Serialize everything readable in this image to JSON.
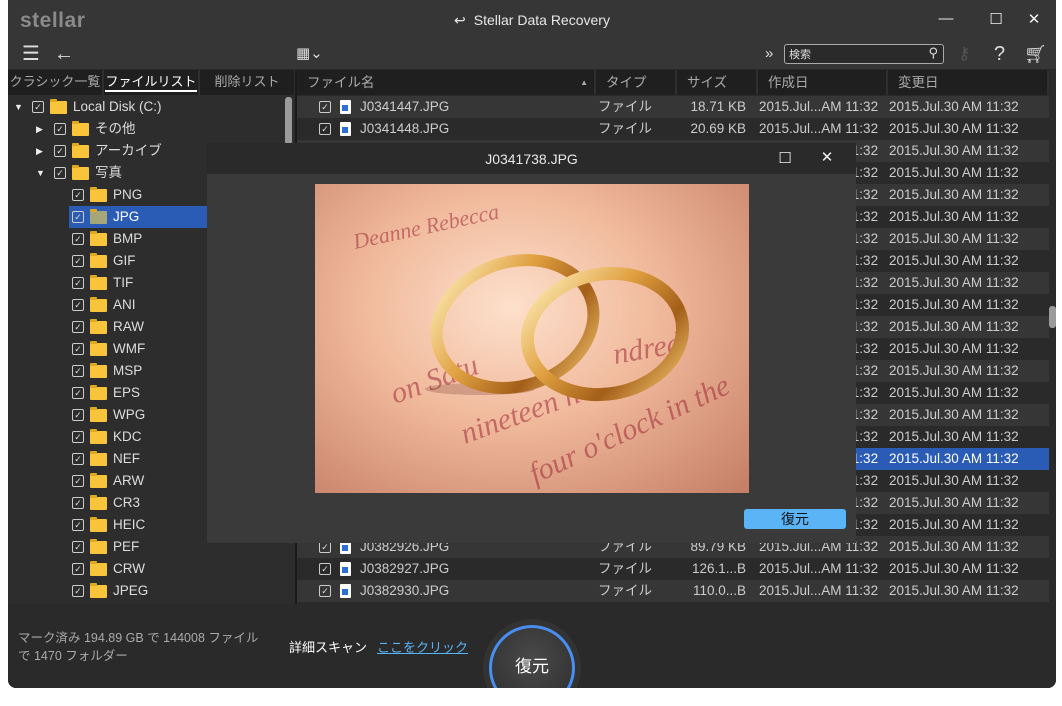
{
  "app": {
    "logo": "stellar",
    "title": "Stellar Data Recovery"
  },
  "window_controls": {
    "minimize": "—",
    "maximize": "☐",
    "close": "✕"
  },
  "toolbar": {
    "search_placeholder": "検索",
    "help": "?"
  },
  "tabs": [
    {
      "label": "クラシック一覧",
      "active": false
    },
    {
      "label": "ファイルリスト",
      "active": true
    },
    {
      "label": "削除リスト",
      "active": false
    }
  ],
  "tree": [
    {
      "label": "Local Disk (C:)",
      "level": 0,
      "arrow": "down"
    },
    {
      "label": "その他",
      "level": 1,
      "arrow": "right"
    },
    {
      "label": "アーカイブ",
      "level": 1,
      "arrow": "right"
    },
    {
      "label": "写真",
      "level": 1,
      "arrow": "down"
    },
    {
      "label": "PNG",
      "level": 2
    },
    {
      "label": "JPG",
      "level": 2,
      "selected": true
    },
    {
      "label": "BMP",
      "level": 2
    },
    {
      "label": "GIF",
      "level": 2
    },
    {
      "label": "TIF",
      "level": 2
    },
    {
      "label": "ANI",
      "level": 2
    },
    {
      "label": "RAW",
      "level": 2
    },
    {
      "label": "WMF",
      "level": 2
    },
    {
      "label": "MSP",
      "level": 2
    },
    {
      "label": "EPS",
      "level": 2
    },
    {
      "label": "WPG",
      "level": 2
    },
    {
      "label": "KDC",
      "level": 2
    },
    {
      "label": "NEF",
      "level": 2
    },
    {
      "label": "ARW",
      "level": 2
    },
    {
      "label": "CR3",
      "level": 2
    },
    {
      "label": "HEIC",
      "level": 2
    },
    {
      "label": "PEF",
      "level": 2
    },
    {
      "label": "CRW",
      "level": 2
    },
    {
      "label": "JPEG",
      "level": 2
    }
  ],
  "columns": [
    "ファイル名",
    "タイプ",
    "サイズ",
    "作成日",
    "変更日"
  ],
  "rows": [
    {
      "name": "J0341447.JPG",
      "type": "ファイル",
      "size": "18.71 KB",
      "created": "2015.Jul...AM 11:32",
      "modified": "2015.Jul.30 AM 11:32"
    },
    {
      "name": "J0341448.JPG",
      "type": "ファイル",
      "size": "20.69 KB",
      "created": "2015.Jul...AM 11:32",
      "modified": "2015.Jul.30 AM 11:32"
    },
    {
      "created": "2015.Jul...AM 11:32",
      "modified": "2015.Jul.30 AM 11:32"
    },
    {
      "created": "2015.Jul...AM 11:32",
      "modified": "2015.Jul.30 AM 11:32"
    },
    {
      "created": "2015.Jul...AM 11:32",
      "modified": "2015.Jul.30 AM 11:32"
    },
    {
      "created": "2015.Jul...AM 11:32",
      "modified": "2015.Jul.30 AM 11:32"
    },
    {
      "created": "2015.Jul...AM 11:32",
      "modified": "2015.Jul.30 AM 11:32"
    },
    {
      "created": "2015.Jul...AM 11:32",
      "modified": "2015.Jul.30 AM 11:32"
    },
    {
      "created": "2015.Jul...AM 11:32",
      "modified": "2015.Jul.30 AM 11:32"
    },
    {
      "created": "2015.Jul...AM 11:32",
      "modified": "2015.Jul.30 AM 11:32"
    },
    {
      "created": "2015.Jul...AM 11:32",
      "modified": "2015.Jul.30 AM 11:32"
    },
    {
      "created": "2015.Jul...AM 11:32",
      "modified": "2015.Jul.30 AM 11:32"
    },
    {
      "created": "2015.Jul...AM 11:32",
      "modified": "2015.Jul.30 AM 11:32"
    },
    {
      "created": "2015.Jul...AM 11:32",
      "modified": "2015.Jul.30 AM 11:32"
    },
    {
      "created": "2015.Jul...AM 11:32",
      "modified": "2015.Jul.30 AM 11:32"
    },
    {
      "created": "2015.Jul...AM 11:32",
      "modified": "2015.Jul.30 AM 11:32"
    },
    {
      "created": "2015.Jul...AM 11:32",
      "modified": "2015.Jul.30 AM 11:32",
      "selected": true
    },
    {
      "created": "2015.Jul...AM 11:32",
      "modified": "2015.Jul.30 AM 11:32"
    },
    {
      "created": "2015.Jul...AM 11:32",
      "modified": "2015.Jul.30 AM 11:32"
    },
    {
      "created": "2015.Jul...AM 11:32",
      "modified": "2015.Jul.30 AM 11:32"
    },
    {
      "name": "J0382926.JPG",
      "type": "ファイル",
      "size": "89.79 KB",
      "created": "2015.Jul...AM 11:32",
      "modified": "2015.Jul.30 AM 11:32"
    },
    {
      "name": "J0382927.JPG",
      "type": "ファイル",
      "size": "126.1...B",
      "created": "2015.Jul...AM 11:32",
      "modified": "2015.Jul.30 AM 11:32"
    },
    {
      "name": "J0382930.JPG",
      "type": "ファイル",
      "size": "110.0...B",
      "created": "2015.Jul...AM 11:32",
      "modified": "2015.Jul.30 AM 11:32"
    }
  ],
  "preview": {
    "title": "J0341738.JPG",
    "recover_label": "復元",
    "image_text": [
      "Deanne Rebecca",
      "on Satu",
      "nineteen h",
      "four o'clock in the",
      "ndred"
    ]
  },
  "status": {
    "line1": "マーク済み 194.89 GB で 144008 ファイル",
    "line2": "で 1470 フォルダー"
  },
  "deep_scan": {
    "label": "詳細スキャン",
    "link": "ここをクリック"
  },
  "recover_button": "復元",
  "colors": {
    "accent": "#2a5bb5",
    "link": "#5ab4f5",
    "ring": "#4a8df0"
  }
}
